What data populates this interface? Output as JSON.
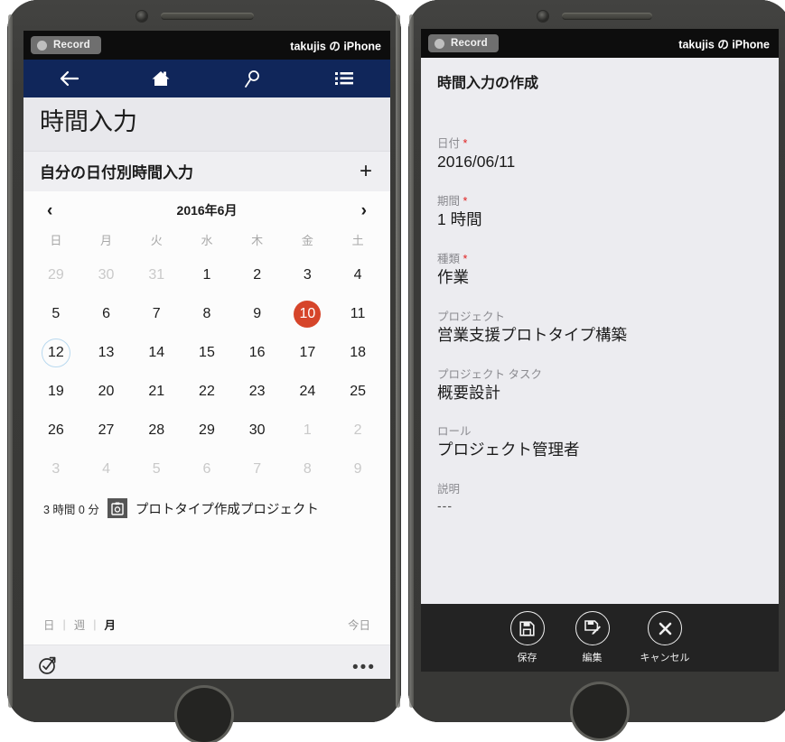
{
  "left_device": {
    "record_bar": {
      "button_label": "Record",
      "device_name": "takujis の iPhone"
    },
    "navbar": {
      "back_icon": "back-arrow-icon",
      "home_icon": "home-icon",
      "search_icon": "search-icon",
      "list_icon": "list-icon"
    },
    "page_title": "時間入力",
    "section": {
      "title": "自分の日付別時間入力",
      "add_label": "+"
    },
    "calendar": {
      "month_label": "2016年6月",
      "prev_label": "‹",
      "next_label": "›",
      "weekdays": [
        "日",
        "月",
        "火",
        "水",
        "木",
        "金",
        "土"
      ],
      "weeks": [
        [
          {
            "d": "29",
            "muted": true
          },
          {
            "d": "30",
            "muted": true
          },
          {
            "d": "31",
            "muted": true
          },
          {
            "d": "1"
          },
          {
            "d": "2"
          },
          {
            "d": "3"
          },
          {
            "d": "4"
          }
        ],
        [
          {
            "d": "5"
          },
          {
            "d": "6"
          },
          {
            "d": "7"
          },
          {
            "d": "8"
          },
          {
            "d": "9"
          },
          {
            "d": "10",
            "selected": true
          },
          {
            "d": "11"
          }
        ],
        [
          {
            "d": "12",
            "today": true
          },
          {
            "d": "13"
          },
          {
            "d": "14"
          },
          {
            "d": "15"
          },
          {
            "d": "16"
          },
          {
            "d": "17"
          },
          {
            "d": "18"
          }
        ],
        [
          {
            "d": "19"
          },
          {
            "d": "20"
          },
          {
            "d": "21"
          },
          {
            "d": "22"
          },
          {
            "d": "23"
          },
          {
            "d": "24"
          },
          {
            "d": "25"
          }
        ],
        [
          {
            "d": "26"
          },
          {
            "d": "27"
          },
          {
            "d": "28"
          },
          {
            "d": "29"
          },
          {
            "d": "30"
          },
          {
            "d": "1",
            "muted": true
          },
          {
            "d": "2",
            "muted": true
          }
        ],
        [
          {
            "d": "3",
            "muted": true
          },
          {
            "d": "4",
            "muted": true
          },
          {
            "d": "5",
            "muted": true
          },
          {
            "d": "6",
            "muted": true
          },
          {
            "d": "7",
            "muted": true
          },
          {
            "d": "8",
            "muted": true
          },
          {
            "d": "9",
            "muted": true
          }
        ]
      ]
    },
    "entry": {
      "duration": "3 時間 0 分",
      "icon": "clipboard-icon",
      "title": "プロトタイプ作成プロジェクト"
    },
    "footer": {
      "view_day": "日",
      "view_week": "週",
      "view_month": "月",
      "separator": "|",
      "today_label": "今日"
    },
    "bottom_bar": {
      "left_icon": "check-circle-arrow-icon",
      "more_label": "•••"
    }
  },
  "right_device": {
    "record_bar": {
      "button_label": "Record",
      "device_name": "takujis の iPhone"
    },
    "form": {
      "title": "時間入力の作成",
      "required_mark": "*",
      "fields": [
        {
          "label": "日付",
          "required": true,
          "value": "2016/06/11"
        },
        {
          "label": "期間",
          "required": true,
          "value": "1 時間"
        },
        {
          "label": "種類",
          "required": true,
          "value": "作業"
        },
        {
          "label": "プロジェクト",
          "required": false,
          "value": "営業支援プロトタイプ構築"
        },
        {
          "label": "プロジェクト タスク",
          "required": false,
          "value": "概要設計"
        },
        {
          "label": "ロール",
          "required": false,
          "value": "プロジェクト管理者"
        },
        {
          "label": "説明",
          "required": false,
          "value": "---"
        }
      ]
    },
    "actions": [
      {
        "label": "保存",
        "icon": "save-floppy-icon"
      },
      {
        "label": "編集",
        "icon": "edit-pencil-icon"
      },
      {
        "label": "キャンセル",
        "icon": "close-x-icon"
      }
    ]
  },
  "colors": {
    "navbar": "#10265a",
    "selected_day": "#d6452a",
    "today_ring": "#b9d9ef",
    "required": "#e02020",
    "action_bar": "#232323"
  }
}
